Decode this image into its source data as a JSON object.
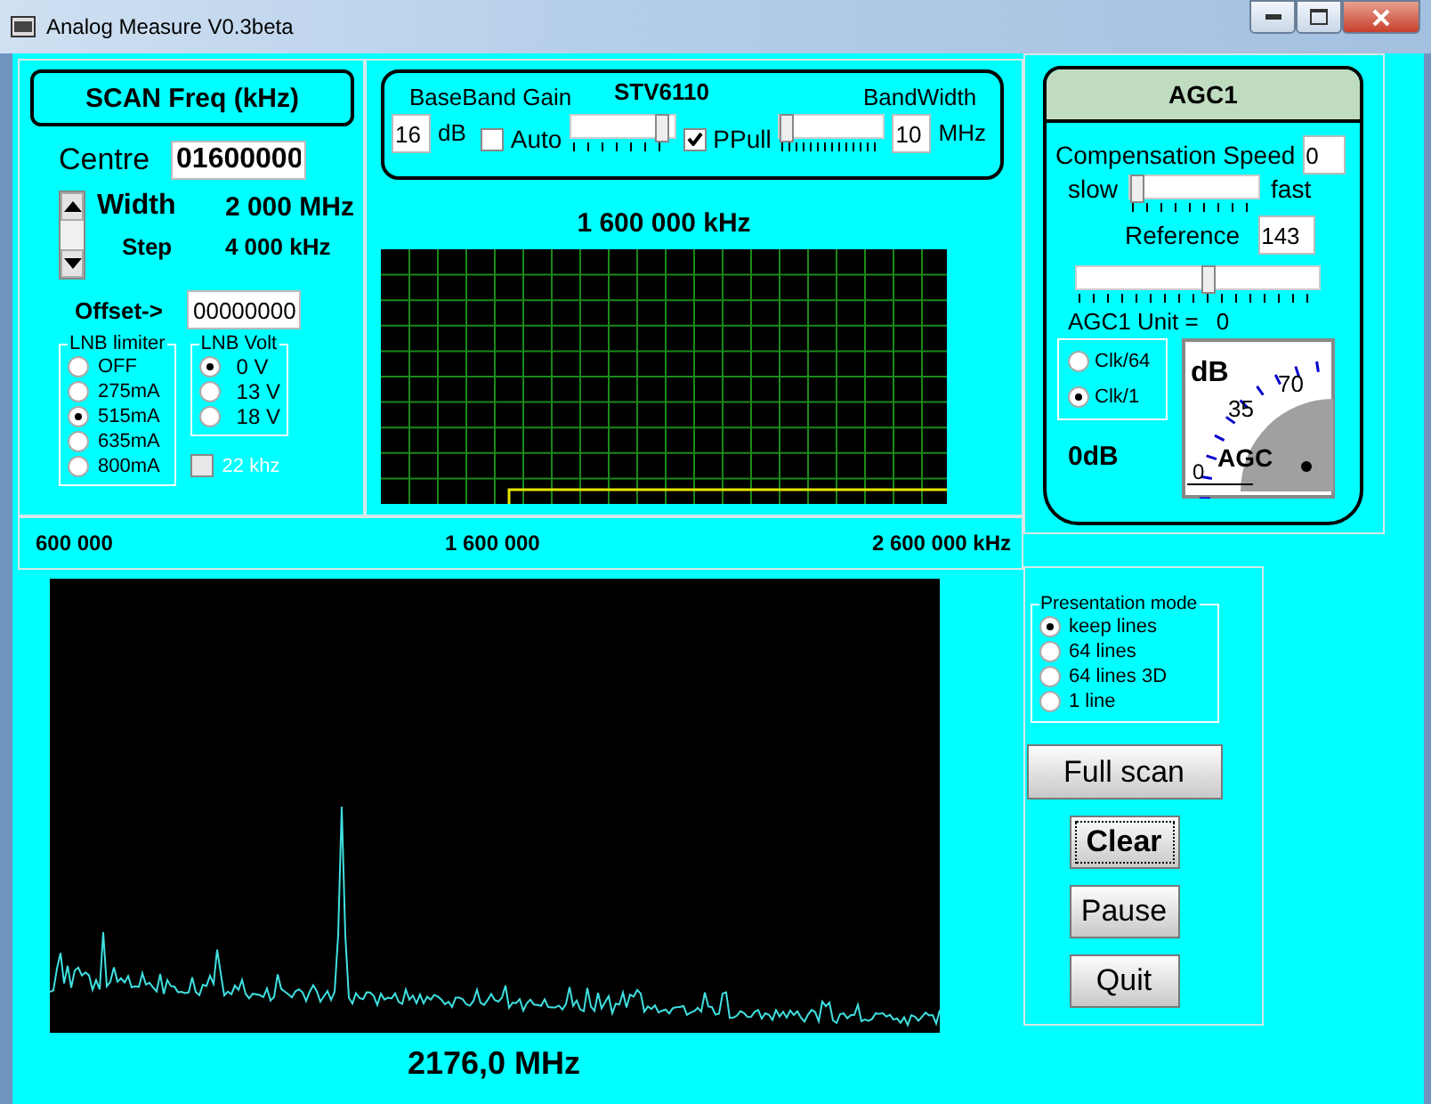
{
  "window": {
    "title": "Analog Measure V0.3beta"
  },
  "scan": {
    "title": "SCAN Freq (kHz)",
    "centre_label": "Centre",
    "centre_value": "01600000",
    "width_label": "Width",
    "width_value": "2 000 MHz",
    "step_label": "Step",
    "step_value": "4 000 kHz",
    "offset_label": "Offset->",
    "offset_value": "00000000",
    "lnb_limiter": {
      "title": "LNB limiter",
      "options": [
        {
          "label": "OFF",
          "selected": false
        },
        {
          "label": "275mA",
          "selected": false
        },
        {
          "label": "515mA",
          "selected": true
        },
        {
          "label": "635mA",
          "selected": false
        },
        {
          "label": "800mA",
          "selected": false
        }
      ]
    },
    "lnb_volt": {
      "title": "LNB Volt",
      "options": [
        {
          "label": "0 V",
          "selected": true
        },
        {
          "label": "13 V",
          "selected": false
        },
        {
          "label": "18 V",
          "selected": false
        }
      ]
    },
    "tone": {
      "label": "22 khz",
      "checked": false,
      "disabled": true
    }
  },
  "tuner": {
    "title": "STV6110",
    "gain_label": "BaseBand Gain",
    "gain_value": "16",
    "gain_unit": "dB",
    "auto": {
      "label": "Auto",
      "checked": false
    },
    "gain_slider": {
      "level": 0.95
    },
    "ppull": {
      "label": "PPull",
      "checked": true
    },
    "bandwidth_label": "BandWidth",
    "bandwidth_slider": {
      "level": 0
    },
    "bandwidth_value": "10",
    "bandwidth_unit": "MHz"
  },
  "centre_readout": "1 600 000 kHz",
  "axis": [
    "600 000",
    "1 600 000",
    "2 600 000 kHz"
  ],
  "agc": {
    "title": "AGC1",
    "speed_label": "Compensation Speed",
    "speed_value": "0",
    "slow": "slow",
    "fast": "fast",
    "speed_slider": {
      "level": 0
    },
    "reference_label": "Reference",
    "reference_value": "143",
    "reference_slider": {
      "level": 0.55
    },
    "unit_label": "AGC1 Unit =",
    "unit_value": "0",
    "clock": [
      {
        "label": "Clk/64",
        "selected": false
      },
      {
        "label": "Clk/1",
        "selected": true
      }
    ],
    "gain_readout": "0dB",
    "meter": {
      "unit": "dB",
      "high": "70",
      "mid": "35",
      "low": "0",
      "name": "AGC"
    }
  },
  "frequency_readout": "2176,0 MHz",
  "presentation": {
    "title": "Presentation mode",
    "options": [
      {
        "label": "keep lines",
        "selected": true
      },
      {
        "label": "64 lines",
        "selected": false
      },
      {
        "label": "64 lines 3D",
        "selected": false
      },
      {
        "label": "1 line",
        "selected": false
      }
    ]
  },
  "buttons": [
    {
      "label": "Full scan",
      "kind": "wide",
      "focused": false
    },
    {
      "label": "Clear",
      "kind": "small",
      "focused": true
    },
    {
      "label": "Pause",
      "kind": "small",
      "focused": false
    },
    {
      "label": "Quit",
      "kind": "small",
      "focused": false
    }
  ]
}
